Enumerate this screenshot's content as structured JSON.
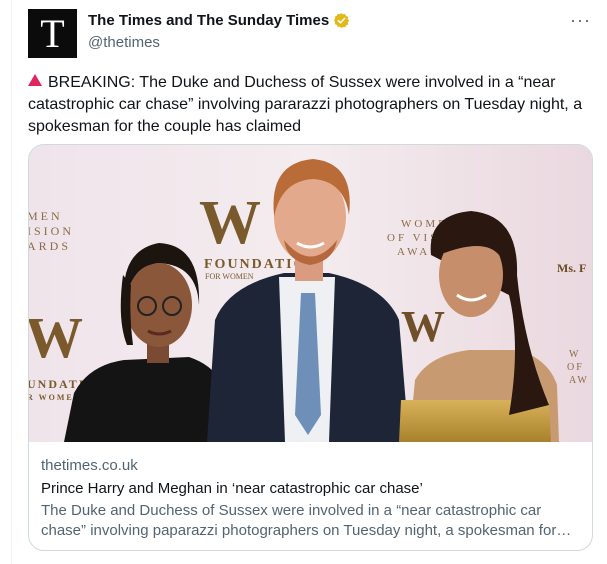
{
  "account": {
    "avatar_letter": "T",
    "display_name": "The Times and The Sunday Times",
    "handle": "@thetimes",
    "verified_color": "#e2b719"
  },
  "tweet": {
    "text": "BREAKING: The Duke and Duchess of Sussex were involved in a “near catastrophic car chase” involving pararazzi photographers on Tuesday night, a spokesman for the couple has claimed",
    "alert_icon": "red-triangle-icon",
    "more_icon": "···"
  },
  "card": {
    "domain": "thetimes.co.uk",
    "title": "Prince Harry and Meghan in ‘near catastrophic car chase’",
    "description": "The Duke and Duchess of Sussex were involved in a “near catastrophic car chase” involving paparazzi photographers on Tuesday night, a spokesman for…",
    "photo": {
      "backdrop_left": "MEN\nISION\nARDS",
      "backdrop_center": "FOUNDATION",
      "backdrop_center_sub": "FOR WOMEN",
      "backdrop_right": "WOMEN\nOF VIS\nAWA",
      "backdrop_far_right": "Ms. F",
      "backdrop_lower_left": "UNDATI\nR WOMEN",
      "backdrop_lower_right": "W\nOF\nAW"
    }
  }
}
